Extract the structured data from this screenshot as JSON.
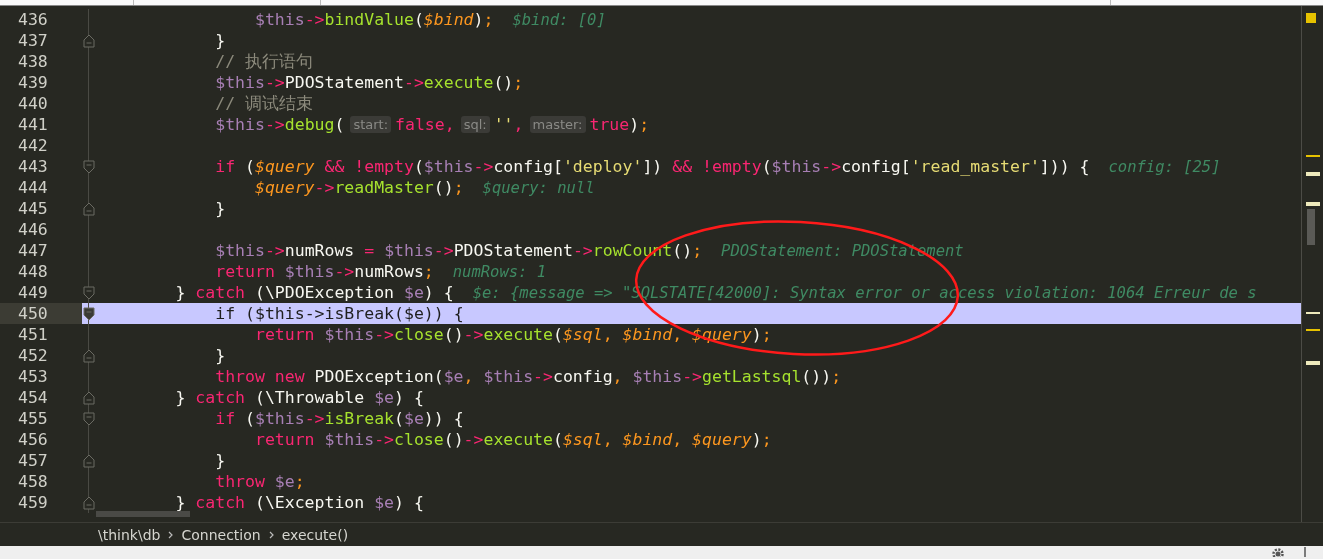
{
  "editor": {
    "lines": [
      {
        "number": "436",
        "fold_open": false,
        "fold_close": false,
        "selected": false,
        "segments": [
          {
            "kind": "code",
            "tokens": [
              {
                "kind": "var",
                "text": "                $this"
              },
              {
                "kind": "op",
                "text": "->"
              },
              {
                "kind": "fn",
                "text": "bindValue"
              },
              {
                "kind": "plain",
                "text": "("
              },
              {
                "kind": "param",
                "text": "$bind"
              },
              {
                "kind": "plain",
                "text": ")"
              },
              {
                "kind": "semi",
                "text": ";"
              }
            ]
          },
          {
            "kind": "value_hint",
            "text": "$bind: [0]"
          }
        ]
      },
      {
        "number": "437",
        "fold_open": false,
        "fold_close": true,
        "selected": false,
        "segments": [
          {
            "kind": "code",
            "tokens": [
              {
                "kind": "plain",
                "text": "            }"
              }
            ]
          }
        ]
      },
      {
        "number": "438",
        "fold_open": false,
        "fold_close": false,
        "selected": false,
        "segments": [
          {
            "kind": "code",
            "tokens": [
              {
                "kind": "comment",
                "text": "            // 执行语句"
              }
            ]
          }
        ]
      },
      {
        "number": "439",
        "fold_open": false,
        "fold_close": false,
        "selected": false,
        "segments": [
          {
            "kind": "code",
            "tokens": [
              {
                "kind": "var",
                "text": "            $this"
              },
              {
                "kind": "op",
                "text": "->"
              },
              {
                "kind": "plain",
                "text": "PDOStatement"
              },
              {
                "kind": "op",
                "text": "->"
              },
              {
                "kind": "fn",
                "text": "execute"
              },
              {
                "kind": "plain",
                "text": "()"
              },
              {
                "kind": "semi",
                "text": ";"
              }
            ]
          }
        ]
      },
      {
        "number": "440",
        "fold_open": false,
        "fold_close": false,
        "selected": false,
        "segments": [
          {
            "kind": "code",
            "tokens": [
              {
                "kind": "comment",
                "text": "            // 调试结束"
              }
            ]
          }
        ]
      },
      {
        "number": "441",
        "fold_open": false,
        "fold_close": false,
        "selected": false,
        "segments": [
          {
            "kind": "code",
            "tokens": [
              {
                "kind": "var",
                "text": "            $this"
              },
              {
                "kind": "op",
                "text": "->"
              },
              {
                "kind": "fn",
                "text": "debug"
              },
              {
                "kind": "plain",
                "text": "("
              }
            ]
          },
          {
            "kind": "param_hint",
            "text": "start:"
          },
          {
            "kind": "code",
            "tokens": [
              {
                "kind": "kw",
                "text": "false,"
              }
            ]
          },
          {
            "kind": "param_hint",
            "text": "sql:"
          },
          {
            "kind": "code",
            "tokens": [
              {
                "kind": "str",
                "text": "''"
              },
              {
                "kind": "kw",
                "text": ","
              }
            ]
          },
          {
            "kind": "param_hint",
            "text": "master:"
          },
          {
            "kind": "code",
            "tokens": [
              {
                "kind": "kw",
                "text": "true"
              },
              {
                "kind": "plain",
                "text": ")"
              },
              {
                "kind": "semi",
                "text": ";"
              }
            ]
          }
        ]
      },
      {
        "number": "442",
        "fold_open": false,
        "fold_close": false,
        "selected": false
      },
      {
        "number": "443",
        "fold_open": true,
        "fold_close": false,
        "selected": false,
        "segments": [
          {
            "kind": "code",
            "tokens": [
              {
                "kind": "kw",
                "text": "            if"
              },
              {
                "kind": "plain",
                "text": " ("
              },
              {
                "kind": "param",
                "text": "$query"
              },
              {
                "kind": "kw",
                "text": " && !empty"
              },
              {
                "kind": "plain",
                "text": "("
              },
              {
                "kind": "var",
                "text": "$this"
              },
              {
                "kind": "op",
                "text": "->"
              },
              {
                "kind": "plain",
                "text": "config["
              },
              {
                "kind": "str",
                "text": "'deploy'"
              },
              {
                "kind": "plain",
                "text": "])"
              },
              {
                "kind": "kw",
                "text": " && !empty"
              },
              {
                "kind": "plain",
                "text": "("
              },
              {
                "kind": "var",
                "text": "$this"
              },
              {
                "kind": "op",
                "text": "->"
              },
              {
                "kind": "plain",
                "text": "config["
              },
              {
                "kind": "str",
                "text": "'read_master'"
              },
              {
                "kind": "plain",
                "text": "])) {"
              }
            ]
          },
          {
            "kind": "value_hint",
            "text": "config: [25]"
          }
        ]
      },
      {
        "number": "444",
        "fold_open": false,
        "fold_close": false,
        "selected": false,
        "segments": [
          {
            "kind": "code",
            "tokens": [
              {
                "kind": "param",
                "text": "                $query"
              },
              {
                "kind": "op",
                "text": "->"
              },
              {
                "kind": "fn",
                "text": "readMaster"
              },
              {
                "kind": "plain",
                "text": "()"
              },
              {
                "kind": "semi",
                "text": ";"
              }
            ]
          },
          {
            "kind": "value_hint",
            "text": "$query: null"
          }
        ]
      },
      {
        "number": "445",
        "fold_open": false,
        "fold_close": true,
        "selected": false,
        "segments": [
          {
            "kind": "code",
            "tokens": [
              {
                "kind": "plain",
                "text": "            }"
              }
            ]
          }
        ]
      },
      {
        "number": "446",
        "fold_open": false,
        "fold_close": false,
        "selected": false
      },
      {
        "number": "447",
        "fold_open": false,
        "fold_close": false,
        "selected": false,
        "segments": [
          {
            "kind": "code",
            "tokens": [
              {
                "kind": "var",
                "text": "            $this"
              },
              {
                "kind": "op",
                "text": "->"
              },
              {
                "kind": "plain",
                "text": "numRows"
              },
              {
                "kind": "kw",
                "text": " = "
              },
              {
                "kind": "var",
                "text": "$this"
              },
              {
                "kind": "op",
                "text": "->"
              },
              {
                "kind": "plain",
                "text": "PDOStatement"
              },
              {
                "kind": "op",
                "text": "->"
              },
              {
                "kind": "fn",
                "text": "rowCount"
              },
              {
                "kind": "plain",
                "text": "()"
              },
              {
                "kind": "semi",
                "text": ";"
              }
            ]
          },
          {
            "kind": "value_hint",
            "text": "PDOStatement: PDOStatement"
          }
        ]
      },
      {
        "number": "448",
        "fold_open": false,
        "fold_close": false,
        "selected": false,
        "segments": [
          {
            "kind": "code",
            "tokens": [
              {
                "kind": "kw",
                "text": "            return "
              },
              {
                "kind": "var",
                "text": "$this"
              },
              {
                "kind": "op",
                "text": "->"
              },
              {
                "kind": "plain",
                "text": "numRows"
              },
              {
                "kind": "semi",
                "text": ";"
              }
            ]
          },
          {
            "kind": "value_hint",
            "text": "numRows: 1"
          }
        ]
      },
      {
        "number": "449",
        "fold_open": true,
        "fold_close": false,
        "selected": false,
        "segments": [
          {
            "kind": "code",
            "tokens": [
              {
                "kind": "plain",
                "text": "        } "
              },
              {
                "kind": "kw",
                "text": "catch"
              },
              {
                "kind": "plain",
                "text": " (\\PDOException "
              },
              {
                "kind": "var",
                "text": "$e"
              },
              {
                "kind": "plain",
                "text": ") {"
              }
            ]
          },
          {
            "kind": "value_hint",
            "text": "$e: {message => \"SQLSTATE[42000]: Syntax error or access violation: 1064 Erreur de s"
          }
        ]
      },
      {
        "number": "450",
        "fold_open": true,
        "fold_close": false,
        "selected": true,
        "segments": [
          {
            "kind": "code",
            "tokens": [
              {
                "kind": "kw",
                "text": "            if"
              },
              {
                "kind": "plain",
                "text": " ("
              },
              {
                "kind": "var",
                "text": "$this"
              },
              {
                "kind": "op",
                "text": "->"
              },
              {
                "kind": "fn",
                "text": "isBreak"
              },
              {
                "kind": "plain",
                "text": "("
              },
              {
                "kind": "var",
                "text": "$e"
              },
              {
                "kind": "plain",
                "text": ")) {"
              }
            ]
          }
        ]
      },
      {
        "number": "451",
        "fold_open": false,
        "fold_close": false,
        "selected": false,
        "segments": [
          {
            "kind": "code",
            "tokens": [
              {
                "kind": "kw",
                "text": "                return "
              },
              {
                "kind": "var",
                "text": "$this"
              },
              {
                "kind": "op",
                "text": "->"
              },
              {
                "kind": "fn",
                "text": "close"
              },
              {
                "kind": "plain",
                "text": "()"
              },
              {
                "kind": "op",
                "text": "->"
              },
              {
                "kind": "fn",
                "text": "execute"
              },
              {
                "kind": "plain",
                "text": "("
              },
              {
                "kind": "param",
                "text": "$sql"
              },
              {
                "kind": "semi",
                "text": ","
              },
              {
                "kind": "param",
                "text": " $bind"
              },
              {
                "kind": "semi",
                "text": ","
              },
              {
                "kind": "param",
                "text": " $query"
              },
              {
                "kind": "plain",
                "text": ")"
              },
              {
                "kind": "semi",
                "text": ";"
              }
            ]
          }
        ]
      },
      {
        "number": "452",
        "fold_open": false,
        "fold_close": true,
        "selected": false,
        "segments": [
          {
            "kind": "code",
            "tokens": [
              {
                "kind": "plain",
                "text": "            }"
              }
            ]
          }
        ]
      },
      {
        "number": "453",
        "fold_open": false,
        "fold_close": false,
        "selected": false,
        "segments": [
          {
            "kind": "code",
            "tokens": [
              {
                "kind": "kw",
                "text": "            throw new "
              },
              {
                "kind": "plain",
                "text": "PDOException("
              },
              {
                "kind": "var",
                "text": "$e"
              },
              {
                "kind": "semi",
                "text": ","
              },
              {
                "kind": "var",
                "text": " $this"
              },
              {
                "kind": "op",
                "text": "->"
              },
              {
                "kind": "plain",
                "text": "config"
              },
              {
                "kind": "semi",
                "text": ","
              },
              {
                "kind": "var",
                "text": " $this"
              },
              {
                "kind": "op",
                "text": "->"
              },
              {
                "kind": "fn",
                "text": "getLastsql"
              },
              {
                "kind": "plain",
                "text": "())"
              },
              {
                "kind": "semi",
                "text": ";"
              }
            ]
          }
        ]
      },
      {
        "number": "454",
        "fold_open": false,
        "fold_close": true,
        "selected": false,
        "segments": [
          {
            "kind": "code",
            "tokens": [
              {
                "kind": "plain",
                "text": "        } "
              },
              {
                "kind": "kw",
                "text": "catch"
              },
              {
                "kind": "plain",
                "text": " (\\Throwable "
              },
              {
                "kind": "var",
                "text": "$e"
              },
              {
                "kind": "plain",
                "text": ") {"
              }
            ]
          }
        ]
      },
      {
        "number": "455",
        "fold_open": true,
        "fold_close": false,
        "selected": false,
        "segments": [
          {
            "kind": "code",
            "tokens": [
              {
                "kind": "kw",
                "text": "            if"
              },
              {
                "kind": "plain",
                "text": " ("
              },
              {
                "kind": "var",
                "text": "$this"
              },
              {
                "kind": "op",
                "text": "->"
              },
              {
                "kind": "fn",
                "text": "isBreak"
              },
              {
                "kind": "plain",
                "text": "("
              },
              {
                "kind": "var",
                "text": "$e"
              },
              {
                "kind": "plain",
                "text": ")) {"
              }
            ]
          }
        ]
      },
      {
        "number": "456",
        "fold_open": false,
        "fold_close": false,
        "selected": false,
        "segments": [
          {
            "kind": "code",
            "tokens": [
              {
                "kind": "kw",
                "text": "                return "
              },
              {
                "kind": "var",
                "text": "$this"
              },
              {
                "kind": "op",
                "text": "->"
              },
              {
                "kind": "fn",
                "text": "close"
              },
              {
                "kind": "plain",
                "text": "()"
              },
              {
                "kind": "op",
                "text": "->"
              },
              {
                "kind": "fn",
                "text": "execute"
              },
              {
                "kind": "plain",
                "text": "("
              },
              {
                "kind": "param",
                "text": "$sql"
              },
              {
                "kind": "semi",
                "text": ","
              },
              {
                "kind": "param",
                "text": " $bind"
              },
              {
                "kind": "semi",
                "text": ","
              },
              {
                "kind": "param",
                "text": " $query"
              },
              {
                "kind": "plain",
                "text": ")"
              },
              {
                "kind": "semi",
                "text": ";"
              }
            ]
          }
        ]
      },
      {
        "number": "457",
        "fold_open": false,
        "fold_close": true,
        "selected": false,
        "segments": [
          {
            "kind": "code",
            "tokens": [
              {
                "kind": "plain",
                "text": "            }"
              }
            ]
          }
        ]
      },
      {
        "number": "458",
        "fold_open": false,
        "fold_close": false,
        "selected": false,
        "segments": [
          {
            "kind": "code",
            "tokens": [
              {
                "kind": "kw",
                "text": "            throw "
              },
              {
                "kind": "var",
                "text": "$e"
              },
              {
                "kind": "semi",
                "text": ";"
              }
            ]
          }
        ]
      },
      {
        "number": "459",
        "fold_open": false,
        "fold_close": true,
        "selected": false,
        "segments": [
          {
            "kind": "code",
            "tokens": [
              {
                "kind": "plain",
                "text": "        } "
              },
              {
                "kind": "kw",
                "text": "catch"
              },
              {
                "kind": "plain",
                "text": " (\\Exception "
              },
              {
                "kind": "var",
                "text": "$e"
              },
              {
                "kind": "plain",
                "text": ") {"
              }
            ]
          }
        ]
      }
    ]
  },
  "breadcrumb": [
    {
      "text": "\\think\\db"
    },
    {
      "text": "Connection"
    },
    {
      "text": "execute()"
    }
  ]
}
